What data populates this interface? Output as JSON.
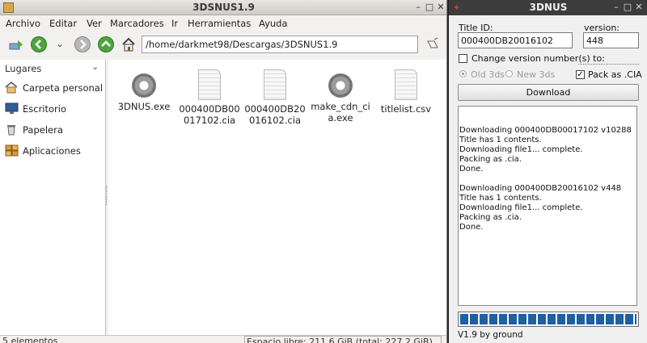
{
  "file_manager": {
    "title": "3DSNUS1.9",
    "menu": [
      "Archivo",
      "Editar",
      "Ver",
      "Marcadores",
      "Ir",
      "Herramientas",
      "Ayuda"
    ],
    "path": "/home/darkmet98/Descargas/3DSNUS1.9",
    "sidebar": {
      "header": "Lugares",
      "items": [
        {
          "label": "Carpeta personal",
          "icon": "home-folder-icon"
        },
        {
          "label": "Escritorio",
          "icon": "desktop-icon"
        },
        {
          "label": "Papelera",
          "icon": "trash-icon"
        },
        {
          "label": "Aplicaciones",
          "icon": "applications-icon"
        }
      ]
    },
    "files": [
      {
        "name": "3DNUS.exe",
        "icon": "gear-icon"
      },
      {
        "name": "000400DB00017102.cia",
        "icon": "document-icon"
      },
      {
        "name": "000400DB20016102.cia",
        "icon": "document-icon"
      },
      {
        "name": "make_cdn_cia.exe",
        "icon": "gear-icon"
      },
      {
        "name": "titlelist.csv",
        "icon": "document-icon"
      }
    ],
    "status": {
      "count": "5 elementos",
      "free_space": "Espacio libre: 211,6 GiB (total: 227,2 GiB)"
    }
  },
  "dnus": {
    "title": "3DNUS",
    "title_id_label": "Title ID:",
    "title_id_value": "000400DB20016102",
    "version_label": "version:",
    "version_value": "448",
    "change_version_label": "Change version number(s) to:",
    "change_version_checked": false,
    "old3ds_label": "Old 3ds",
    "new3ds_label": "New 3ds",
    "pack_cia_label": "Pack as .CIA",
    "pack_cia_checked": true,
    "download_button": "Download",
    "log_lines": [
      "Downloading 000400DB00017102 v10288",
      "Title has 1 contents.",
      "Downloading file1... complete.",
      "Packing as .cia.",
      "Done.",
      "",
      "Downloading 000400DB20016102 v448",
      "Title has 1 contents.",
      "Downloading file1... complete.",
      "Packing as .cia.",
      "Done."
    ],
    "progress": 1.0,
    "progress_color": "#1d5fa8",
    "footer": "V1.9 by ground"
  }
}
